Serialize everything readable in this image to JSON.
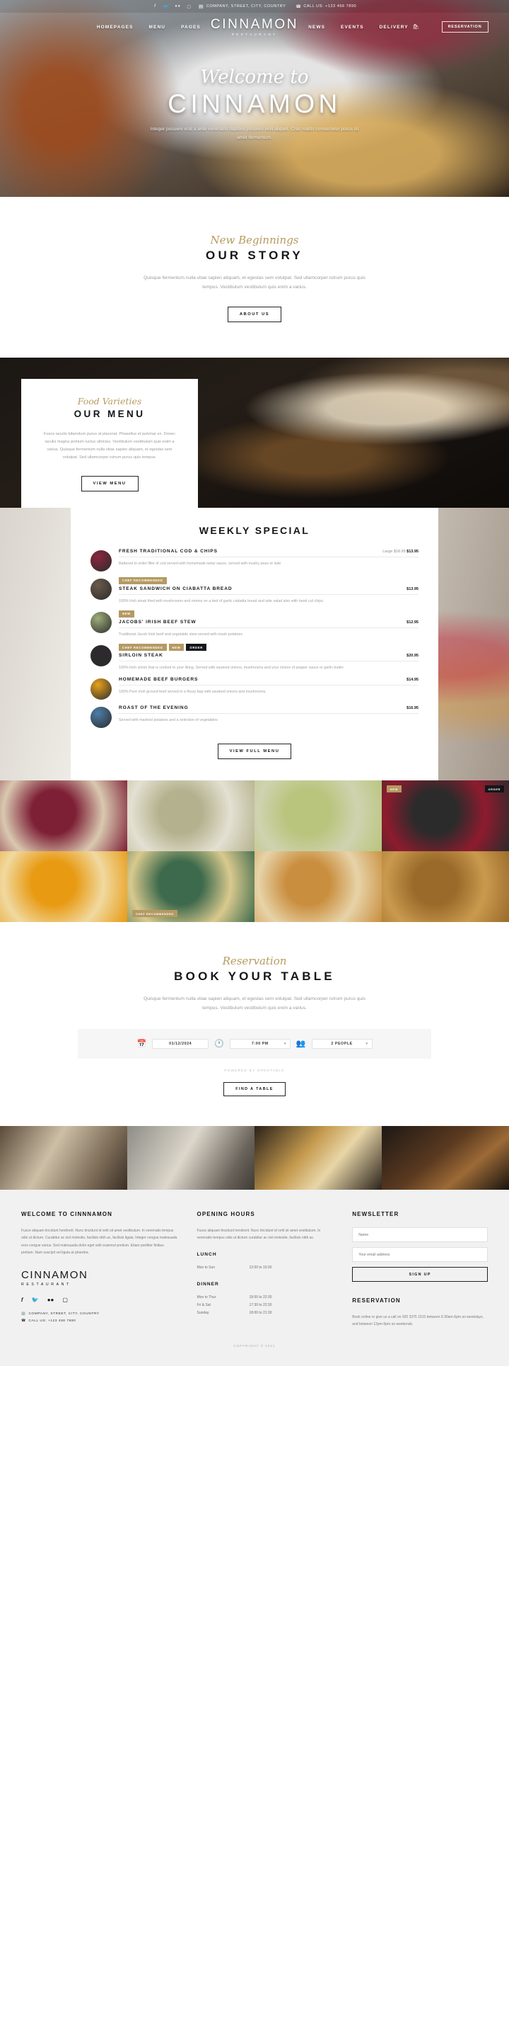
{
  "topbar": {
    "social": [
      "facebook-icon",
      "twitter-icon",
      "flickr-icon",
      "instagram-icon"
    ],
    "address": "COMPANY, STREET, CITY, COUNTRY",
    "phone": "CALL US: +123 456 7890"
  },
  "nav": {
    "left": [
      "HOMEPAGES",
      "MENU",
      "PAGES"
    ],
    "right": [
      "NEWS",
      "EVENTS",
      "DELIVERY"
    ],
    "brand": "CINNAMON",
    "brand_sub": "RESTAURANT",
    "reservation": "RESERVATION"
  },
  "hero": {
    "script": "Welcome to",
    "title": "CINNAMON",
    "text": "Integer posuere erat a ante venenatis dapibus posuere velit aliquet. Cras mattis consectetur purus sit amet fermentum."
  },
  "story": {
    "script": "New Beginnings",
    "title": "OUR STORY",
    "text": "Quisque fermentum nulla vitae sapien aliquam, et egestas sem volutpat. Sed ullamcorper rutrum purus quis tempus. Vestibulum vestibulum quis enim a varius.",
    "button": "ABOUT US"
  },
  "menu_section": {
    "script": "Food Varieties",
    "title": "OUR MENU",
    "text": "Fusce iaculis bibendum purus at placerat. Phasellus et pulvinar ex. Donec iaculis magna pretium luctus ultricies. Vestibulum vestibulum quis enim a varius. Quisque fermentum nulla vitae sapien aliquam, et egestas sem volutpat. Sed ullamcorper rutrum purus quis tempus.",
    "button": "VIEW MENU"
  },
  "weekly": {
    "title": "WEEKLY SPECIAL",
    "button": "VIEW FULL MENU",
    "dishes": [
      {
        "tags": [],
        "name": "FRESH TRADITIONAL COD & CHIPS",
        "price_large": "Large $18.95",
        "price": "$13.95",
        "desc": "Battered to order fillet of cod served with homemade tartar sauce, served with mushy peas or side",
        "thumb_color": "#8b2740"
      },
      {
        "tags": [
          "CHEF RECOMMENDED"
        ],
        "name": "STEAK SANDWICH ON CIABATTA BREAD",
        "price_large": "",
        "price": "$13.95",
        "desc": "100% Irish steak fried with mushrooms and onions on a bed of garlic ciabatta bread and side salad also with hand cut chips.",
        "thumb_color": "#6b5a4a"
      },
      {
        "tags": [
          "NEW"
        ],
        "name": "JACOBS' IRISH BEEF STEW",
        "price_large": "",
        "price": "$12.95",
        "desc": "Traditional Jacob Irish beef and vegetable stew served with mash potatoes",
        "thumb_color": "#9fae7a"
      },
      {
        "tags": [
          "CHEF RECOMMENDED",
          "NEW",
          "ORDER"
        ],
        "name": "SIRLOIN STEAK",
        "price_large": "",
        "price": "$20.95",
        "desc": "100% Irish sirloin that is cooked to your liking. Served with sauteed onions, mushrooms and your choice of pepper sauce or garlic butter.",
        "thumb_color": "#2c2a2e"
      },
      {
        "tags": [],
        "name": "HOMEMADE BEEF BURGERS",
        "price_large": "",
        "price": "$14.95",
        "desc": "100% Pure Irish ground beef served in a floury bap with sauteed onions and mushrooms.",
        "thumb_color": "#e8a21c"
      },
      {
        "tags": [],
        "name": "ROAST OF THE EVENING",
        "price_large": "",
        "price": "$16.95",
        "desc": "Served with mashed potatoes and a selection of vegetables",
        "thumb_color": "#4d7ea8"
      }
    ]
  },
  "gallery": {
    "tiles": [
      {
        "tag": "",
        "tag2": "",
        "c1": "#7d1f35",
        "c2": "#d9c8b0",
        "name": "gallery-tile-berry-pie"
      },
      {
        "tag": "",
        "tag2": "",
        "c1": "#b4b28e",
        "c2": "#e4e0d2",
        "name": "gallery-tile-salads"
      },
      {
        "tag": "",
        "tag2": "",
        "c1": "#b9c47c",
        "c2": "#cfd3b0",
        "name": "gallery-tile-green-balls"
      },
      {
        "tag": "NEW",
        "tag2": "ORDER",
        "c1": "#2b2b2b",
        "c2": "#8e1b2e",
        "name": "gallery-tile-raspberries"
      },
      {
        "tag": "",
        "tag2": "",
        "c1": "#e89a12",
        "c2": "#f0d9a0",
        "name": "gallery-tile-pumpkin-soup"
      },
      {
        "tag": "CHEF RECOMMENDED",
        "tag2": "",
        "c1": "#3d6a4c",
        "c2": "#d9c98e",
        "name": "gallery-tile-buddha-bowl"
      },
      {
        "tag": "",
        "tag2": "",
        "c1": "#c98e3e",
        "c2": "#e7d3a8",
        "name": "gallery-tile-waffles"
      },
      {
        "tag": "",
        "tag2": "",
        "c1": "#9a6a2a",
        "c2": "#c99a4e",
        "name": "gallery-tile-granola-tray"
      }
    ]
  },
  "reservation": {
    "script": "Reservation",
    "title": "BOOK YOUR TABLE",
    "text": "Quisque fermentum nulla vitae sapien aliquam, et egestas sem volutpat. Sed ullamcorper rutrum purus quis tempus. Vestibulum vestibulum quis enim a varius.",
    "date": "01/12/2024",
    "time": "7:00 PM",
    "people": "2 PEOPLE",
    "powered": "POWERED BY OPENTABLE",
    "button": "FIND A TABLE"
  },
  "footer": {
    "col1": {
      "heading": "WELCOME TO CINNNAMON",
      "text": "Fusce aliquam tincidunt hendrerit. Nunc tincidunt id velit sit amet vestibulum. In venenatis tempus odio ut dictum. Curabitur ac nisl molestie, facilisis nibh ac, facilisis ligula. Integer congue malesuada eros congue varius. Sed malesuada dolor eget velit euismod pretium. Etiam porttitor finibus pretium. Nam suscipit vel ligula at pharetra.",
      "logo": "CINNAMON",
      "logo_sub": "RESTAURANT",
      "social": [
        "facebook-icon",
        "twitter-icon",
        "flickr-icon",
        "instagram-icon"
      ],
      "address": "COMPANY, STREET, CITY, COUNTRY",
      "phone": "CALL US: +123 456 7890"
    },
    "col2": {
      "heading": "OPENING HOURS",
      "text": "Fusce aliquam tincidunt hendrerit. Nunc tincidunt id velit sit amet vestibulum. In venenatis tempus odio ut dictum curabitur ac nisl molestie, facilisis nibh ac.",
      "lunch_label": "LUNCH",
      "lunch": [
        {
          "days": "Mon to Sun",
          "hours": "12:00 to 15:00"
        }
      ],
      "dinner_label": "DINNER",
      "dinner": [
        {
          "days": "Mon to Thur",
          "hours": "18:00 to 22:30"
        },
        {
          "days": "Fri & Sat",
          "hours": "17:30 to 22:30"
        },
        {
          "days": "Sunday",
          "hours": "18:00 to 21:30"
        }
      ]
    },
    "col3": {
      "newsletter_heading": "NEWSLETTER",
      "name_placeholder": "Name",
      "email_placeholder": "Your email address",
      "signup": "SIGN UP",
      "reservation_heading": "RESERVATION",
      "reservation_text": "Book online or give us a call on 020 3375 1515 between 9.30am-6pm on weekdays, and between 12pm-5pm on weekends."
    },
    "copyright": "COPYRIGHT © 2021"
  }
}
